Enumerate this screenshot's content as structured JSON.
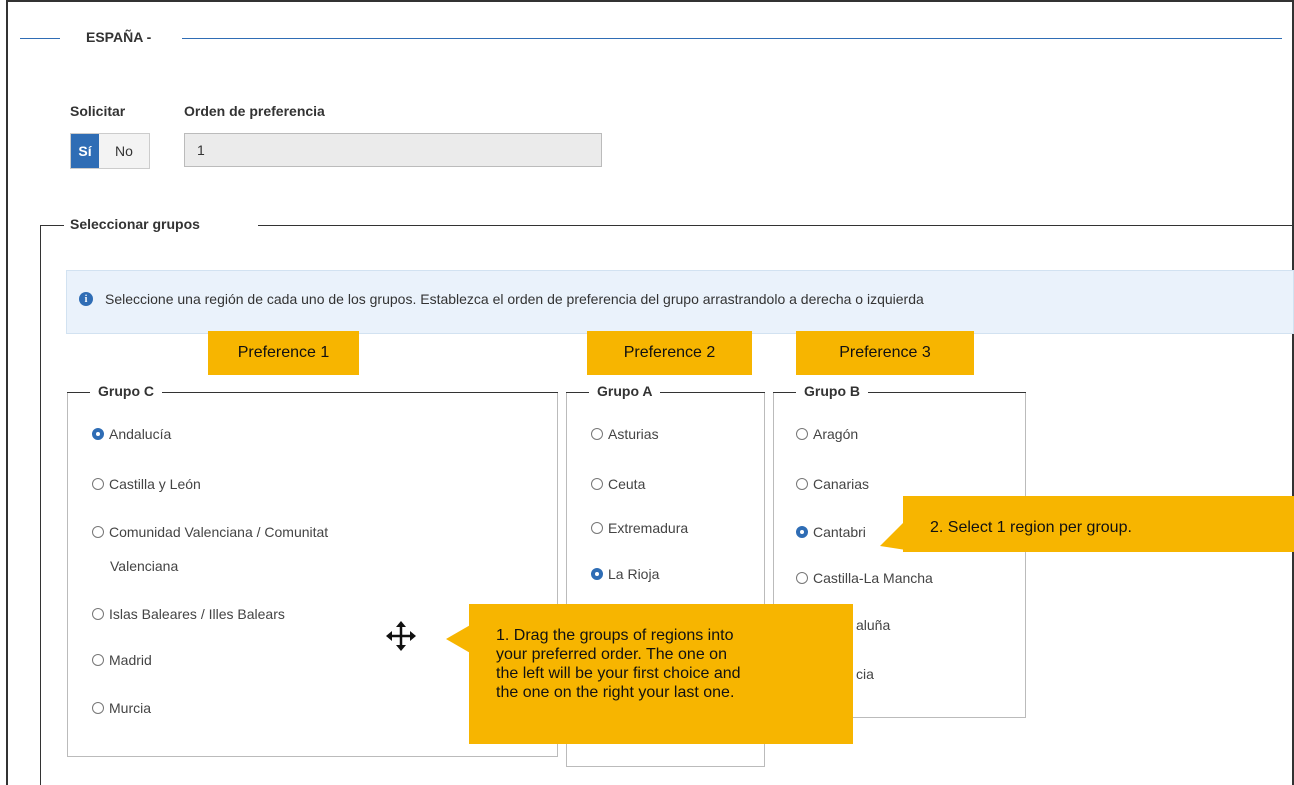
{
  "section": {
    "title": "ESPAÑA -"
  },
  "request": {
    "label": "Solicitar",
    "yes_label": "Sí",
    "no_label": "No",
    "selected": "Sí"
  },
  "order": {
    "label": "Orden de preferencia",
    "value": "1"
  },
  "groups_section": {
    "title": "Seleccionar grupos",
    "info_icon": "info-icon",
    "info_text": "Seleccione una región de cada uno de los grupos. Establezca el orden de preferencia del grupo arrastrandolo a derecha o izquierda"
  },
  "preferences": [
    "Preference 1",
    "Preference 2",
    "Preference 3"
  ],
  "groups": [
    {
      "title": "Grupo C",
      "options": [
        "Andalucía",
        "Castilla y León",
        "Comunidad Valenciana / Comunitat",
        "Islas Baleares / Illes Balears",
        "Madrid",
        "Murcia"
      ],
      "option_continuation": "Valenciana",
      "selected": "Andalucía"
    },
    {
      "title": "Grupo A",
      "options": [
        "Asturias",
        "Ceuta",
        "Extremadura",
        "La Rioja"
      ],
      "selected": "La Rioja"
    },
    {
      "title": "Grupo B",
      "options": [
        "Aragón",
        "Canarias",
        "Cantabria",
        "Castilla-La Mancha",
        "Cataluña",
        "Galicia"
      ],
      "visible_options": [
        "Aragón",
        "Canarias",
        "Cantabri",
        "Castilla-La Mancha",
        "aluña",
        "cia"
      ],
      "selected": "Cantabria"
    }
  ],
  "callouts": {
    "drag": [
      "1. Drag the groups of regions into",
      "your preferred order. The one on",
      "the left will be your first choice and",
      "the one on the right your last one."
    ],
    "select": "2. Select 1 region per group."
  },
  "move_icon": "move-icon",
  "colors": {
    "accent": "#2f6db5",
    "callout": "#f7b500",
    "info_bg": "#eaf2fb"
  }
}
